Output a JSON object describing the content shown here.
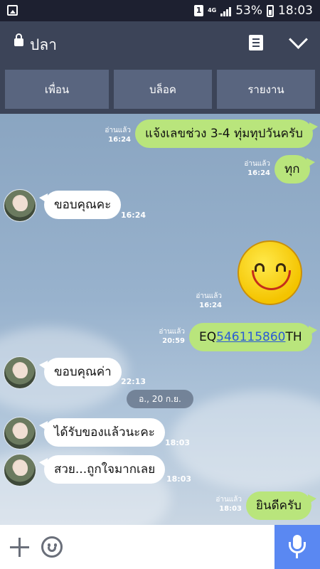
{
  "status_bar": {
    "sim": "1",
    "network": "4G",
    "battery": "53%",
    "time": "18:03"
  },
  "header": {
    "title": "ปลา"
  },
  "actions": {
    "friend": "เพื่อน",
    "block": "บล็อค",
    "report": "รายงาน"
  },
  "messages": [
    {
      "side": "out",
      "text": "แจ้งเลขช่วง 3-4 ทุ่มทุปวันครับ",
      "read": "อ่านแล้ว",
      "time": "16:24"
    },
    {
      "side": "out",
      "text": "ทุก",
      "read": "อ่านแล้ว",
      "time": "16:24"
    },
    {
      "side": "in",
      "text": "ขอบคุณคะ",
      "time": "16:24"
    },
    {
      "side": "out",
      "sticker": "smiley-sticker",
      "read": "อ่านแล้ว",
      "time": "16:24"
    },
    {
      "side": "out",
      "prefix": "EQ",
      "link": "546115860",
      "suffix": "TH",
      "read": "อ่านแล้ว",
      "time": "20:59"
    },
    {
      "side": "in",
      "text": "ขอบคุณค่า",
      "time": "22:13"
    },
    {
      "side": "in",
      "text": "ได้รับของแล้วนะคะ",
      "time": "18:03"
    },
    {
      "side": "in",
      "text": "สวย...ถูกใจมากเลย",
      "time": "18:03"
    },
    {
      "side": "out",
      "text": "ยินดีครับ",
      "read": "อ่านแล้ว",
      "time": "18:03"
    }
  ],
  "date_separator": "อ., 20 ก.ย.",
  "icons": {
    "lock": "lock-icon",
    "note": "note-icon",
    "collapse": "chevron-down-icon",
    "add": "plus-icon",
    "emoji": "emoji-icon",
    "mic": "microphone-icon"
  },
  "colors": {
    "header": "#3c4458",
    "outgoing_bubble": "#b9e57c",
    "incoming_bubble": "#ffffff",
    "mic_button": "#5a88f2",
    "link": "#2a5bd6"
  }
}
